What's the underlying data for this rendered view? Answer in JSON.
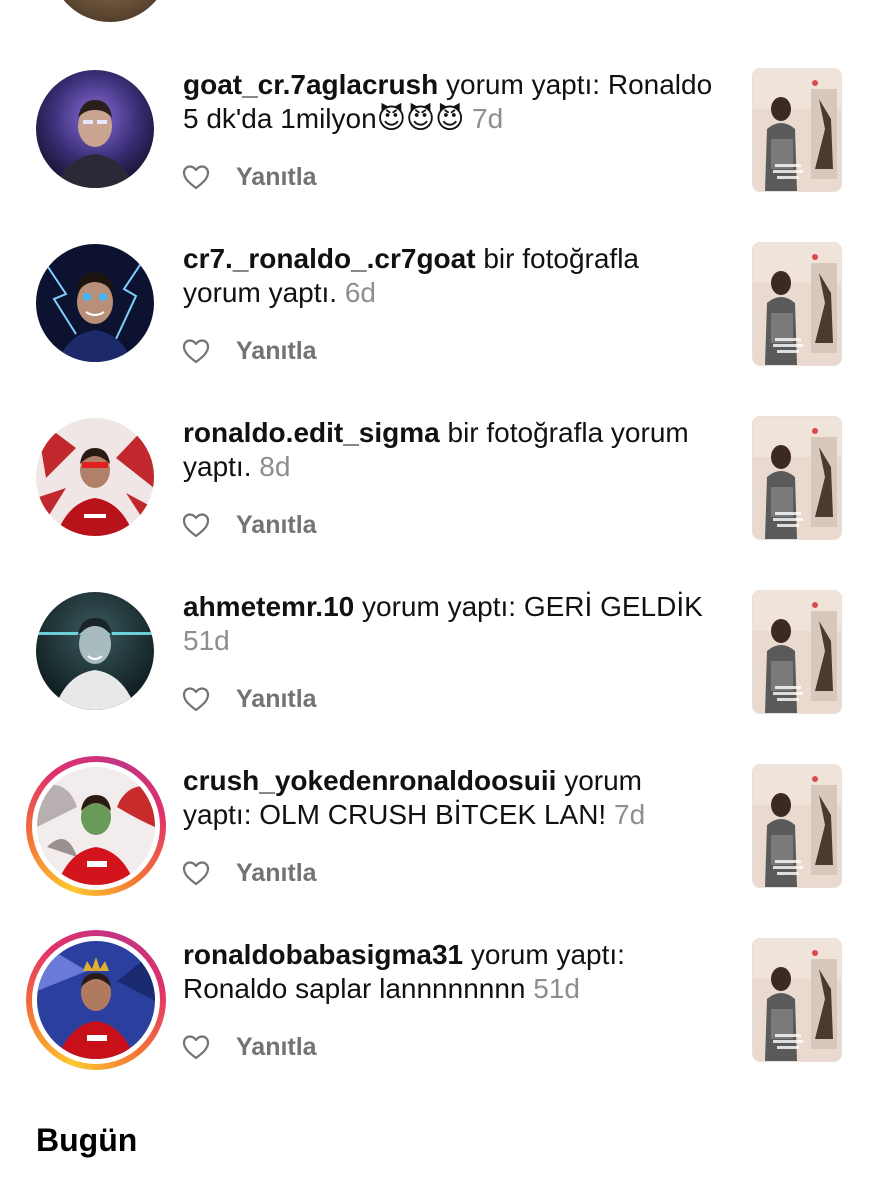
{
  "notifications": [
    {
      "username": "goat_cr.7aglacrush",
      "action": " yorum yaptı: Ronaldo 5 dk'da 1milyon",
      "emoji": "😈😈😈",
      "time": " 7d",
      "reply_label": "Yanıtla",
      "story_ring": false
    },
    {
      "username": "cr7._ronaldo_.cr7goat",
      "action": " bir fotoğrafla yorum yaptı.",
      "emoji": "",
      "time": " 6d",
      "reply_label": "Yanıtla",
      "story_ring": false
    },
    {
      "username": "ronaldo.edit_sigma",
      "action": " bir fotoğrafla yorum yaptı.",
      "emoji": "",
      "time": " 8d",
      "reply_label": "Yanıtla",
      "story_ring": false
    },
    {
      "username": "ahmetemr.10",
      "action": " yorum yaptı: GERİ GELDİK",
      "emoji": "",
      "time": " 51d",
      "reply_label": "Yanıtla",
      "story_ring": false
    },
    {
      "username": "crush_yokedenronaldoosuii",
      "action": " yorum yaptı: OLM CRUSH BİTCEK LAN!",
      "emoji": "",
      "time": " 7d",
      "reply_label": "Yanıtla",
      "story_ring": true
    },
    {
      "username": "ronaldobabasigma31",
      "action": " yorum yaptı: Ronaldo saplar lannnnnnnn",
      "emoji": "",
      "time": " 51d",
      "reply_label": "Yanıtla",
      "story_ring": true
    }
  ],
  "section_title": "Bugün",
  "icons": {
    "like": "heart-outline-icon"
  },
  "colors": {
    "text": "#111111",
    "secondary": "#8e8e8e",
    "reply": "#737373",
    "story_ring_start": "#fdc830",
    "story_ring_end": "#c13584"
  }
}
